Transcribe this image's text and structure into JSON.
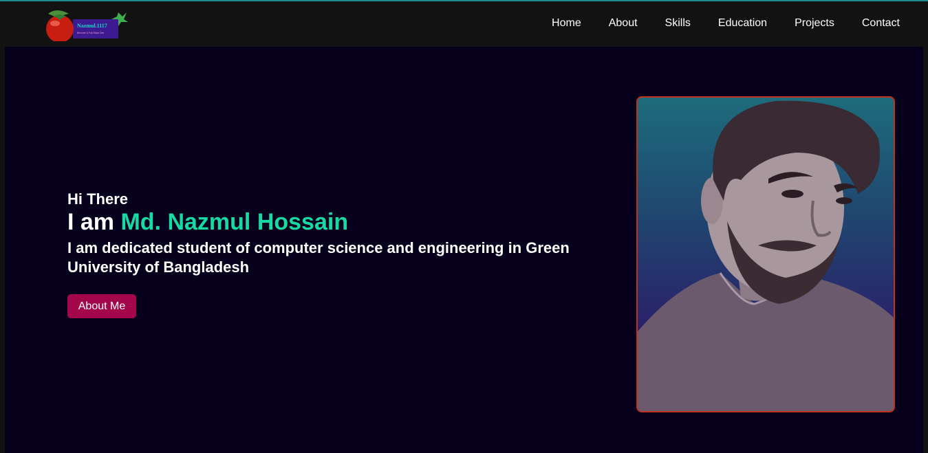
{
  "nav": {
    "logo_text": "Nazmul.1117",
    "logo_tagline": "Become A Full Stack Dev",
    "links": [
      "Home",
      "About",
      "Skills",
      "Education",
      "Projects",
      "Contact"
    ]
  },
  "hero": {
    "greeting": "Hi There",
    "intro_prefix": "I am ",
    "name": "Md. Nazmul Hossain",
    "description": "I am dedicated student of computer science and engineering in Green University of Bangladesh",
    "button_label": "About Me"
  },
  "colors": {
    "accent_name": "#17d9a3",
    "button": "#a3064a",
    "hero_bg": "#07001c",
    "nav_bg": "#121212",
    "photo_border": "#c0321c"
  }
}
